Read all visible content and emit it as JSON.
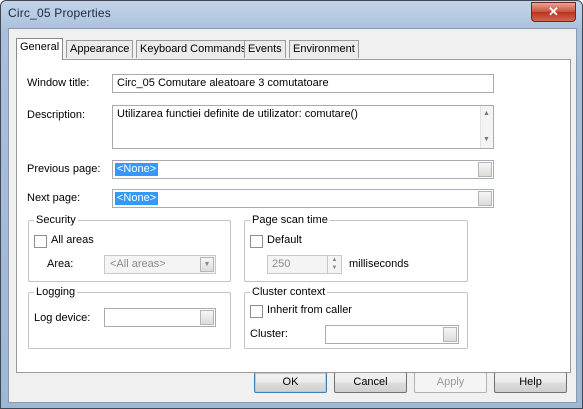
{
  "window": {
    "title": "Circ_05 Properties",
    "close_glyph": "✕"
  },
  "tabs": [
    {
      "label": "General",
      "active": true
    },
    {
      "label": "Appearance"
    },
    {
      "label": "Keyboard Commands"
    },
    {
      "label": "Events"
    },
    {
      "label": "Environment"
    }
  ],
  "general": {
    "window_title_label": "Window title:",
    "window_title_value": "Circ_05 Comutare aleatoare 3 comutatoare",
    "description_label": "Description:",
    "description_value": "Utilizarea functiei definite de utilizator: comutare()",
    "previous_page_label": "Previous page:",
    "previous_page_value": "<None>",
    "next_page_label": "Next page:",
    "next_page_value": "<None>"
  },
  "security": {
    "title": "Security",
    "all_areas_label": "All areas",
    "all_areas_checked": false,
    "area_label": "Area:",
    "area_value": "<All areas>"
  },
  "page_scan": {
    "title": "Page scan time",
    "default_label": "Default",
    "default_checked": false,
    "value": "250",
    "unit": "milliseconds"
  },
  "logging": {
    "title": "Logging",
    "log_device_label": "Log device:",
    "log_device_value": ""
  },
  "cluster": {
    "title": "Cluster context",
    "inherit_label": "Inherit from caller",
    "inherit_checked": false,
    "cluster_label": "Cluster:",
    "cluster_value": ""
  },
  "buttons": {
    "ok": "OK",
    "cancel": "Cancel",
    "apply": "Apply",
    "help": "Help"
  }
}
